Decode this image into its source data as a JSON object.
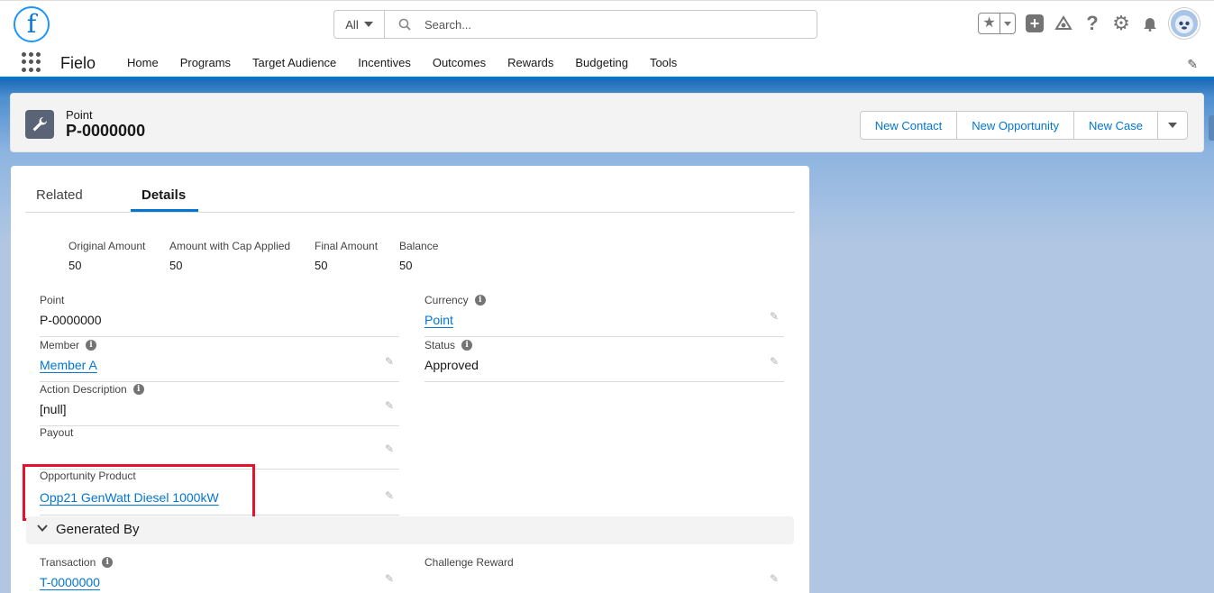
{
  "header": {
    "logo_letter": "f",
    "search_scope": "All",
    "search_placeholder": "Search...",
    "icons": [
      "favorites-star-icon",
      "add-icon",
      "trailhead-icon",
      "help-icon",
      "setup-gear-icon",
      "notifications-bell-icon",
      "user-avatar"
    ]
  },
  "nav": {
    "app_name": "Fielo",
    "items": [
      "Home",
      "Programs",
      "Target Audience",
      "Incentives",
      "Outcomes",
      "Rewards",
      "Budgeting",
      "Tools"
    ]
  },
  "record": {
    "object_type": "Point",
    "name": "P-0000000",
    "actions": [
      "New Contact",
      "New Opportunity",
      "New Case"
    ]
  },
  "tabs": [
    "Related",
    "Details"
  ],
  "active_tab": "Details",
  "highlights": [
    {
      "label": "Original Amount",
      "value": "50"
    },
    {
      "label": "Amount with Cap Applied",
      "value": "50"
    },
    {
      "label": "Final Amount",
      "value": "50"
    },
    {
      "label": "Balance",
      "value": "50"
    }
  ],
  "fields": {
    "point": {
      "label": "Point",
      "value": "P-0000000"
    },
    "currency": {
      "label": "Currency",
      "value": "Point"
    },
    "member": {
      "label": "Member",
      "value": "Member A"
    },
    "status": {
      "label": "Status",
      "value": "Approved"
    },
    "action_description": {
      "label": "Action Description",
      "value": "[null]"
    },
    "payout": {
      "label": "Payout",
      "value": ""
    },
    "opportunity_product": {
      "label": "Opportunity Product",
      "value": "Opp21 GenWatt Diesel 1000kW"
    },
    "transaction": {
      "label": "Transaction",
      "value": "T-0000000"
    },
    "challenge_reward": {
      "label": "Challenge Reward",
      "value": ""
    }
  },
  "sections": {
    "generated_by": "Generated By"
  },
  "colors": {
    "brand": "#0176d3",
    "highlight_box": "#e8112d"
  }
}
